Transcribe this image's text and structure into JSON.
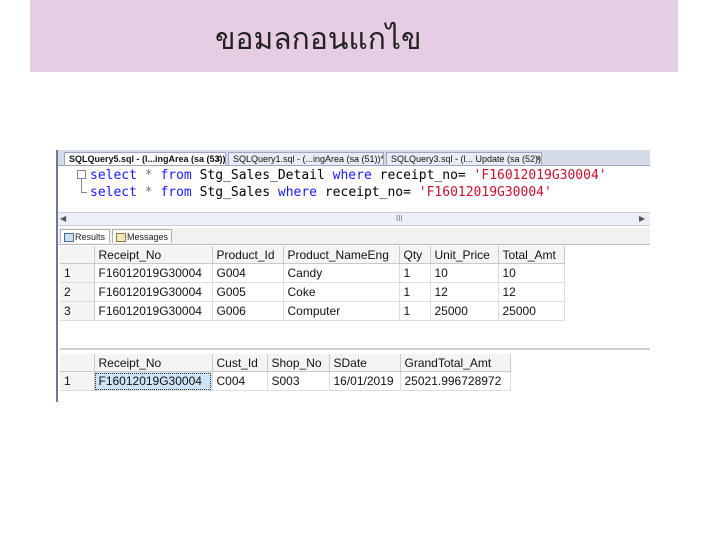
{
  "slide": {
    "title": "ขอมลกอนแกไข"
  },
  "ssms": {
    "tabs": [
      {
        "label": "SQLQuery5.sql - (l...ingArea (sa (53))*",
        "active": true
      },
      {
        "label": "SQLQuery1.sql - (...ingArea (sa (51))*",
        "active": false
      },
      {
        "label": "SQLQuery3.sql - (l... Update (sa (52))*",
        "active": false
      }
    ],
    "close_glyph": "x",
    "editor": {
      "line1": {
        "kw1": "select",
        "star": "*",
        "kw2": "from",
        "table": "Stg_Sales_Detail",
        "kw3": "where",
        "cond": "receipt_no=",
        "value": "'F16012019G30004'"
      },
      "line2": {
        "kw1": "select",
        "star": "*",
        "kw2": "from",
        "table": "Stg_Sales",
        "kw3": "where",
        "cond": "receipt_no=",
        "value": "'F16012019G30004'"
      }
    },
    "scroll_left": "◀",
    "scroll_right": "▶",
    "scroll_grip": "III",
    "result_tabs": {
      "results": "Results",
      "messages": "Messages"
    },
    "grid1": {
      "headers": [
        "Receipt_No",
        "Product_Id",
        "Product_NameEng",
        "Qty",
        "Unit_Price",
        "Total_Amt"
      ],
      "rows": [
        {
          "n": "1",
          "cells": [
            "F16012019G30004",
            "G004",
            "Candy",
            "1",
            "10",
            "10"
          ]
        },
        {
          "n": "2",
          "cells": [
            "F16012019G30004",
            "G005",
            "Coke",
            "1",
            "12",
            "12"
          ]
        },
        {
          "n": "3",
          "cells": [
            "F16012019G30004",
            "G006",
            "Computer",
            "1",
            "25000",
            "25000"
          ]
        }
      ]
    },
    "grid2": {
      "headers": [
        "Receipt_No",
        "Cust_Id",
        "Shop_No",
        "SDate",
        "GrandTotal_Amt"
      ],
      "rows": [
        {
          "n": "1",
          "cells": [
            "F16012019G30004",
            "C004",
            "S003",
            "16/01/2019",
            "25021.996728972"
          ]
        }
      ]
    }
  }
}
